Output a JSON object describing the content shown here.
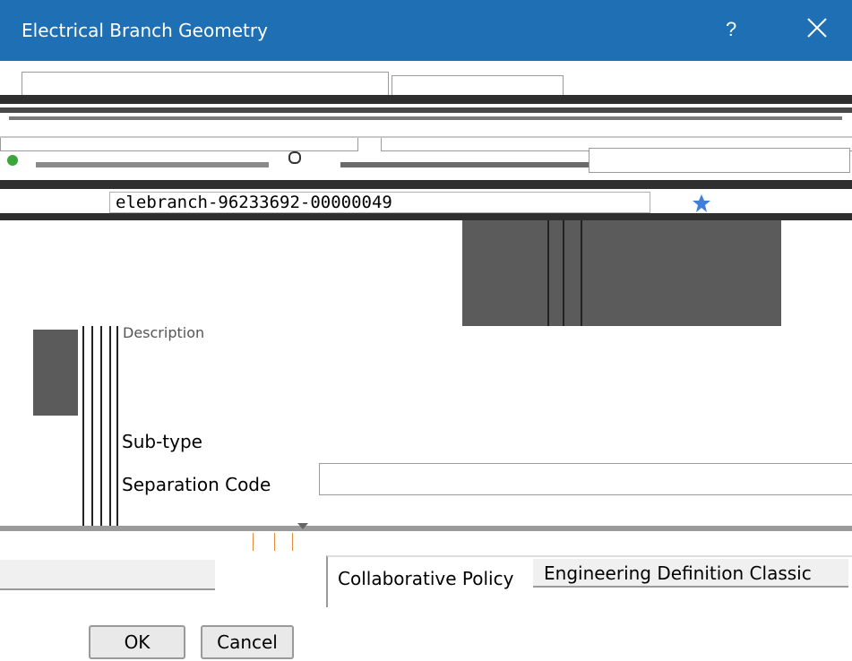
{
  "window": {
    "title": "Electrical Branch Geometry",
    "help_label": "?",
    "close_label": "✕"
  },
  "header": {
    "name_value": "elebranch-96233692-00000049"
  },
  "fields": {
    "description_label": "Description",
    "subtype_label": "Sub-type",
    "separation_code_label": "Separation Code",
    "separation_code_value": "",
    "collaborative_policy_label": "Collaborative Policy",
    "collaborative_policy_value": "Engineering Definition Classic"
  },
  "buttons": {
    "ok_label": "OK",
    "cancel_label": "Cancel"
  },
  "colors": {
    "titlebar": "#1e6fb4",
    "accent_star": "#3f7fd9"
  }
}
